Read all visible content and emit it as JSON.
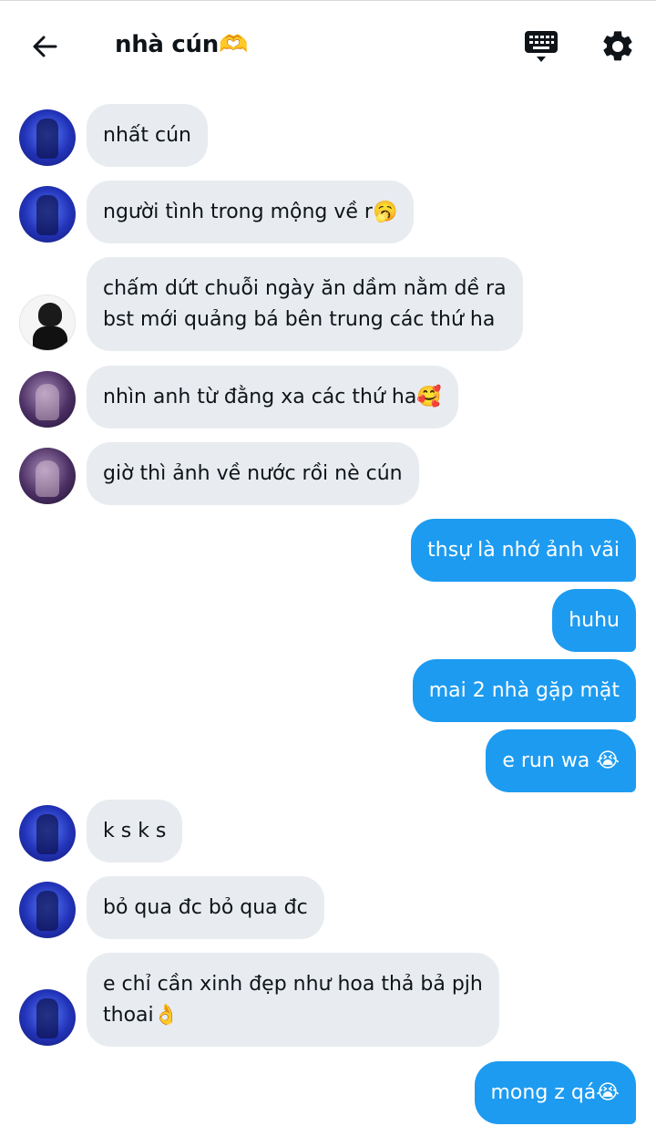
{
  "header": {
    "title": "nhà cún",
    "title_emoji": "🫶"
  },
  "messages": [
    {
      "side": "in",
      "avatar": "blue",
      "text": "nhất cún"
    },
    {
      "side": "in",
      "avatar": "blue",
      "text": "người tình trong mộng về r🥱"
    },
    {
      "side": "in",
      "avatar": "white",
      "lines": [
        "chấm dứt chuỗi ngày ăn dầm nằm dề ra",
        "bst mới quảng bá bên trung các thứ ha"
      ]
    },
    {
      "side": "in",
      "avatar": "purple",
      "text": "nhìn anh từ đằng xa các thứ ha🥰"
    },
    {
      "side": "in",
      "avatar": "purple",
      "text": "giờ thì ảnh về nước rồi nè cún"
    },
    {
      "side": "out",
      "text": "thsự là nhớ ảnh vãi"
    },
    {
      "side": "out",
      "text": "huhu"
    },
    {
      "side": "out",
      "text": "mai 2 nhà gặp mặt"
    },
    {
      "side": "out",
      "text": "e run wa 😭"
    },
    {
      "side": "in",
      "avatar": "blue",
      "text": "k s k s"
    },
    {
      "side": "in",
      "avatar": "blue",
      "text": "bỏ qua đc bỏ qua đc"
    },
    {
      "side": "in",
      "avatar": "blue",
      "lines": [
        "e chỉ cần xinh đẹp như hoa thả bả pjh",
        "thoai👌"
      ]
    },
    {
      "side": "out",
      "text": "mong z qá😭"
    }
  ],
  "colors": {
    "outgoing_bubble": "#1d9bf0",
    "incoming_bubble": "#e8ecf0",
    "text": "#0f1419"
  },
  "icons": {
    "back": "arrow-left-icon",
    "keyboard": "keyboard-icon",
    "settings": "gear-icon"
  }
}
